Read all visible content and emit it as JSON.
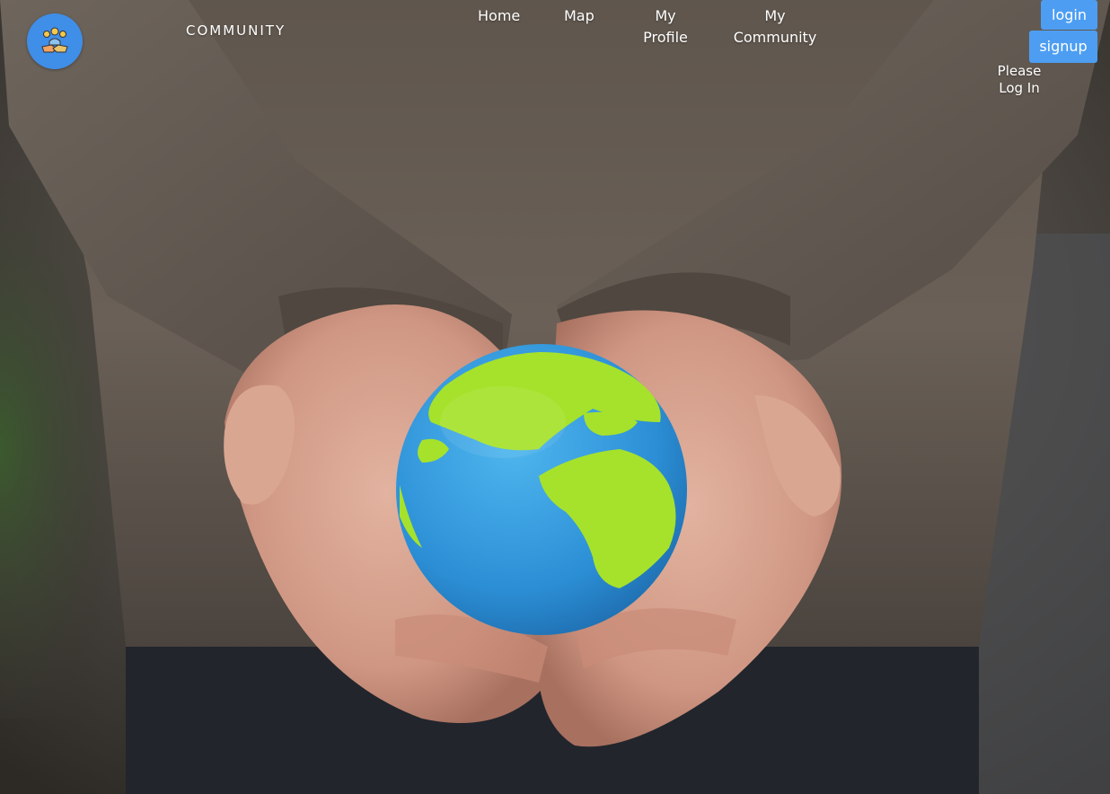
{
  "brand": {
    "name": "COMMUNITY",
    "logo_icon": "community-handshake-icon"
  },
  "nav": {
    "home": "Home",
    "map": "Map",
    "my_profile": [
      "My",
      "Profile"
    ],
    "my_community": [
      "My",
      "Community"
    ]
  },
  "auth": {
    "login_label": "login",
    "signup_label": "signup",
    "status_message": [
      "Please",
      "Log In"
    ]
  },
  "hero": {
    "image_subject": "hands-holding-globe-image"
  },
  "colors": {
    "accent": "#4d9ef2",
    "logo_bg": "#3f8ee8",
    "nav_text": "#ffffff"
  }
}
